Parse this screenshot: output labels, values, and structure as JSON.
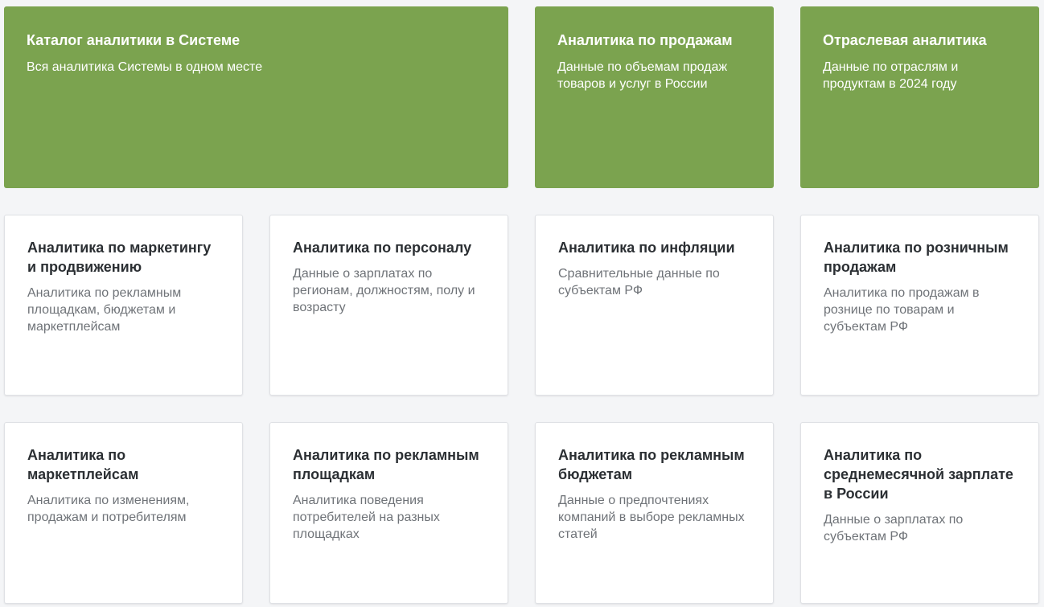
{
  "cards_top": [
    {
      "title": "Каталог аналитики в Системе",
      "desc": "Вся аналитика Системы в одном месте"
    },
    {
      "title": "Аналитика по продажам",
      "desc": "Данные по объемам продаж товаров и услуг в России"
    },
    {
      "title": "Отраслевая аналитика",
      "desc": "Данные по отраслям и продуктам в 2024 году"
    }
  ],
  "cards_row2": [
    {
      "title": "Аналитика по маркетингу и продвижению",
      "desc": "Аналитика по рекламным площадкам, бюджетам и маркетплейсам"
    },
    {
      "title": "Аналитика по персоналу",
      "desc": "Данные о зарплатах по регионам, должностям, полу и возрасту"
    },
    {
      "title": "Аналитика по инфляции",
      "desc": "Сравнительные данные по субъектам РФ"
    },
    {
      "title": "Аналитика по розничным продажам",
      "desc": "Аналитика по продажам в рознице по товарам и субъектам РФ"
    }
  ],
  "cards_row3": [
    {
      "title": "Аналитика по маркетплейсам",
      "desc": "Аналитика по изменениям, продажам и потребителям"
    },
    {
      "title": "Аналитика по рекламным площадкам",
      "desc": "Аналитика поведения потребителей на разных площадках"
    },
    {
      "title": "Аналитика по рекламным бюджетам",
      "desc": "Данные о предпочтениях компаний в выборе рекламных статей"
    },
    {
      "title": "Аналитика по среднемесячной зарплате в России",
      "desc": "Данные о зарплатах по субъектам РФ"
    }
  ],
  "colors": {
    "accent_green": "#7ba34f",
    "background": "#f4f5f7"
  }
}
